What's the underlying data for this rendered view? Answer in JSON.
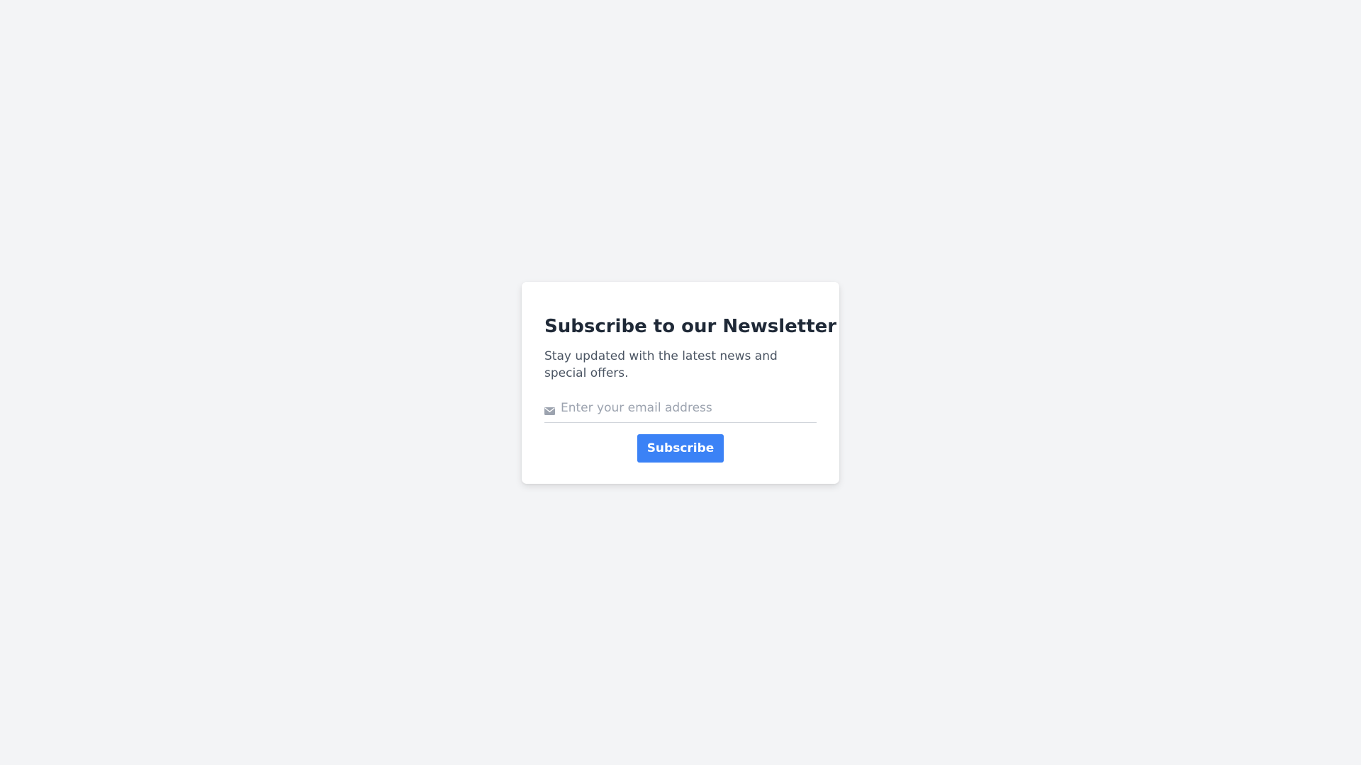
{
  "newsletter": {
    "title": "Subscribe to our Newsletter",
    "subtitle": "Stay updated with the latest news and special offers.",
    "email_placeholder": "Enter your email address",
    "email_value": "",
    "email_icon": "envelope-icon",
    "subscribe_label": "Subscribe"
  },
  "colors": {
    "background": "#f3f4f6",
    "card": "#ffffff",
    "title": "#1f2937",
    "subtitle": "#4b5563",
    "placeholder": "#9ca3af",
    "button": "#3b82f6",
    "button_text": "#ffffff"
  }
}
